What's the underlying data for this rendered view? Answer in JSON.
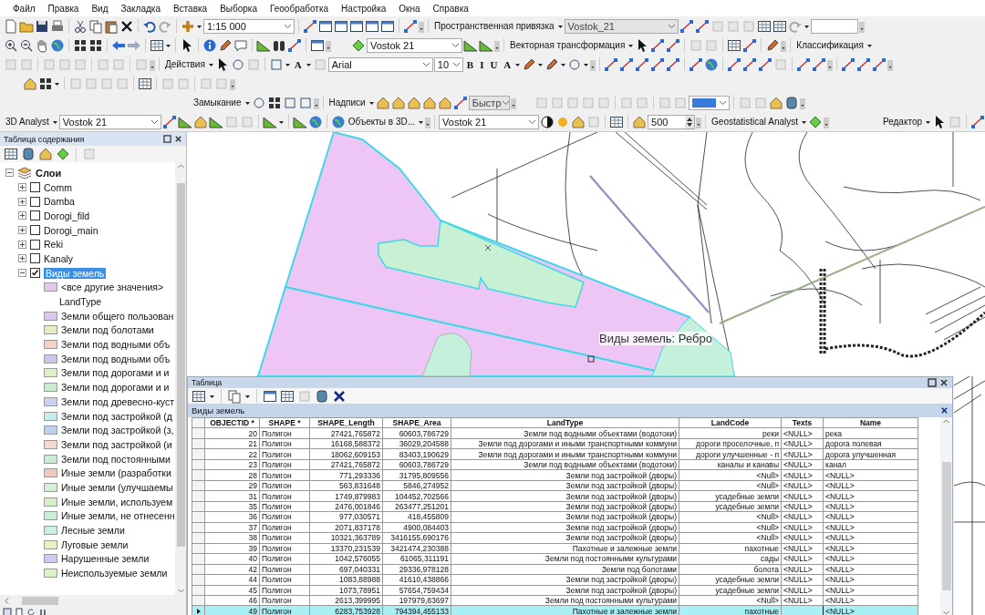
{
  "menu": [
    "Файл",
    "Правка",
    "Вид",
    "Закладка",
    "Вставка",
    "Выборка",
    "Геообработка",
    "Настройка",
    "Окна",
    "Справка"
  ],
  "toolbars": {
    "scale": "1:15 000",
    "georef_label": "Пространственная привязка",
    "georef_layer": {
      "value": "Vostok_21",
      "disabled": true
    },
    "layer_combo": "Vostok 21",
    "vector_transform": "Векторная трансформация",
    "classification": "Классификация",
    "actions": "Действия",
    "font": "Arial",
    "font_size": "10",
    "glyphs": [
      "A",
      "B",
      "I",
      "U",
      "A"
    ],
    "snapping": "Замыкание",
    "labels": "Надписи",
    "quick": {
      "value": "Быстр",
      "disabled": true
    },
    "analyst3d": "3D Analyst",
    "analyst3d_layer": "Vostok 21",
    "objects3d": "Объекты в 3D...",
    "layer_combo2": "Vostok 21",
    "distance": "500",
    "geostat": "Geostatistical Analyst",
    "editor": "Редактор"
  },
  "toc": {
    "title": "Таблица содержания",
    "root": {
      "label": "Слои",
      "expanded": true
    },
    "layers": [
      {
        "name": "Comm",
        "checked": false,
        "expanded": false,
        "selected": false
      },
      {
        "name": "Damba",
        "checked": false,
        "expanded": false,
        "selected": false
      },
      {
        "name": "Dorogi_fild",
        "checked": false,
        "expanded": false,
        "selected": false
      },
      {
        "name": "Dorogi_main",
        "checked": false,
        "expanded": false,
        "selected": false
      },
      {
        "name": "Reki",
        "checked": false,
        "expanded": false,
        "selected": false
      },
      {
        "name": "Kanaly",
        "checked": false,
        "expanded": false,
        "selected": false
      },
      {
        "name": "Виды земель",
        "checked": true,
        "expanded": true,
        "selected": true,
        "children": [
          {
            "kind": "swatch",
            "label": "<все другие значения>",
            "color": "#e6c6f0"
          },
          {
            "kind": "heading",
            "label": "LandType"
          },
          {
            "kind": "swatch",
            "label": "Земли общего пользован",
            "color": "#dcc6ee"
          },
          {
            "kind": "swatch",
            "label": "Земли под болотами",
            "color": "#e8ecc0"
          },
          {
            "kind": "swatch",
            "label": "Земли под водными объ",
            "color": "#f2d2c2"
          },
          {
            "kind": "swatch",
            "label": "Земли под водными объ",
            "color": "#c9c6ec"
          },
          {
            "kind": "swatch",
            "label": "Земли под дорогами и и",
            "color": "#def0c6"
          },
          {
            "kind": "swatch",
            "label": "Земли под дорогами и и",
            "color": "#c8ecd0"
          },
          {
            "kind": "swatch",
            "label": "Земли под древесно-куст",
            "color": "#c8d2f0"
          },
          {
            "kind": "swatch",
            "label": "Земли под застройкой (д",
            "color": "#c6ecec"
          },
          {
            "kind": "swatch",
            "label": "Земли под застройкой (з,",
            "color": "#bed0f0"
          },
          {
            "kind": "swatch",
            "label": "Земли под застройкой (и",
            "color": "#f4d8d0"
          },
          {
            "kind": "swatch",
            "label": "Земли под постоянными",
            "color": "#c8ecd4"
          },
          {
            "kind": "swatch",
            "label": "Иные земли (разработки",
            "color": "#f0c8c0"
          },
          {
            "kind": "swatch",
            "label": "Иные земли (улучшаемы",
            "color": "#d0f0d8"
          },
          {
            "kind": "swatch",
            "label": "Иные земли, используем",
            "color": "#d4f0c8"
          },
          {
            "kind": "swatch",
            "label": "Иные земли, не отнесенн",
            "color": "#c8f0d8"
          },
          {
            "kind": "swatch",
            "label": "Лесные земли",
            "color": "#c8f0e2"
          },
          {
            "kind": "swatch",
            "label": "Луговые земли",
            "color": "#ecf0c0"
          },
          {
            "kind": "swatch",
            "label": "Нарушенные земли",
            "color": "#d0c8f0"
          },
          {
            "kind": "swatch",
            "label": "Неиспользуемые земли",
            "color": "#d8f4c8"
          }
        ]
      }
    ]
  },
  "map": {
    "snap_tip": "Виды земель: Ребро"
  },
  "table": {
    "title": "Таблица",
    "layer_tab": "Виды земель",
    "columns": [
      "OBJECTID *",
      "SHAPE *",
      "SHAPE_Length",
      "SHAPE_Area",
      "LandType",
      "LandCode",
      "Texts",
      "Name"
    ],
    "rows": [
      {
        "objectid": "20",
        "shape": "Полигон",
        "shape_length": "27421,765872",
        "shape_area": "60603,786729",
        "landtype": "Земли под водными объектами (водотоки)",
        "landcode": "реки",
        "texts": "<NULL>",
        "name": "река",
        "selected": false
      },
      {
        "objectid": "21",
        "shape": "Полигон",
        "shape_length": "16168,588372",
        "shape_area": "36029,204588",
        "landtype": "Земли под дорогами и иными транспортными коммуни",
        "landcode": "дороги проселочные, п",
        "texts": "<NULL>",
        "name": "дорога полевая",
        "selected": false
      },
      {
        "objectid": "22",
        "shape": "Полигон",
        "shape_length": "18062,609153",
        "shape_area": "83403,190629",
        "landtype": "Земли под дорогами и иными транспортными коммуни",
        "landcode": "дороги улучшенные - п",
        "texts": "<NULL>",
        "name": "дорога улучшенная",
        "selected": false
      },
      {
        "objectid": "23",
        "shape": "Полигон",
        "shape_length": "27421,765872",
        "shape_area": "60603,786729",
        "landtype": "Земли под водными объектами (водотоки)",
        "landcode": "каналы и канавы",
        "texts": "<NULL>",
        "name": "канал",
        "selected": false
      },
      {
        "objectid": "28",
        "shape": "Полигон",
        "shape_length": "771,293336",
        "shape_area": "31795,809556",
        "landtype": "Земли под застройкой (дворы)",
        "landcode": "<Null>",
        "texts": "<NULL>",
        "name": "<NULL>",
        "selected": false
      },
      {
        "objectid": "29",
        "shape": "Полигон",
        "shape_length": "563,831648",
        "shape_area": "5846,274952",
        "landtype": "Земли под застройкой (дворы)",
        "landcode": "<Null>",
        "texts": "<NULL>",
        "name": "<NULL>",
        "selected": false
      },
      {
        "objectid": "31",
        "shape": "Полигон",
        "shape_length": "1749,879983",
        "shape_area": "104452,702566",
        "landtype": "Земли под застройкой (дворы)",
        "landcode": "усадебные земли",
        "texts": "<NULL>",
        "name": "<NULL>",
        "selected": false
      },
      {
        "objectid": "35",
        "shape": "Полигон",
        "shape_length": "2476,001846",
        "shape_area": "263477,251201",
        "landtype": "Земли под застройкой (дворы)",
        "landcode": "усадебные земли",
        "texts": "<NULL>",
        "name": "<NULL>",
        "selected": false
      },
      {
        "objectid": "36",
        "shape": "Полигон",
        "shape_length": "977,030571",
        "shape_area": "418,455809",
        "landtype": "Земли под застройкой (дворы)",
        "landcode": "<Null>",
        "texts": "<NULL>",
        "name": "<NULL>",
        "selected": false
      },
      {
        "objectid": "37",
        "shape": "Полигон",
        "shape_length": "2071,837178",
        "shape_area": "4900,084403",
        "landtype": "Земли под застройкой (дворы)",
        "landcode": "<Null>",
        "texts": "<NULL>",
        "name": "<NULL>",
        "selected": false
      },
      {
        "objectid": "38",
        "shape": "Полигон",
        "shape_length": "10321,363789",
        "shape_area": "3416155,690176",
        "landtype": "Земли под застройкой (дворы)",
        "landcode": "<Null>",
        "texts": "<NULL>",
        "name": "<NULL>",
        "selected": false
      },
      {
        "objectid": "39",
        "shape": "Полигон",
        "shape_length": "13370,231539",
        "shape_area": "3421474,230388",
        "landtype": "Пахотные и залежные земли",
        "landcode": "пахотные",
        "texts": "<NULL>",
        "name": "<NULL>",
        "selected": false
      },
      {
        "objectid": "40",
        "shape": "Полигон",
        "shape_length": "1042,576055",
        "shape_area": "61065,311191",
        "landtype": "Земли под постоянными культурами",
        "landcode": "сады",
        "texts": "<NULL>",
        "name": "<NULL>",
        "selected": false
      },
      {
        "objectid": "42",
        "shape": "Полигон",
        "shape_length": "697,040331",
        "shape_area": "29336,978128",
        "landtype": "Земли под болотами",
        "landcode": "болота",
        "texts": "<NULL>",
        "name": "<NULL>",
        "selected": false
      },
      {
        "objectid": "44",
        "shape": "Полигон",
        "shape_length": "1083,88988",
        "shape_area": "41610,438866",
        "landtype": "Земли под застройкой (дворы)",
        "landcode": "усадебные земли",
        "texts": "<NULL>",
        "name": "<NULL>",
        "selected": false
      },
      {
        "objectid": "45",
        "shape": "Полигон",
        "shape_length": "1073,78951",
        "shape_area": "57654,759434",
        "landtype": "Земли под застройкой (дворы)",
        "landcode": "усадебные земли",
        "texts": "<NULL>",
        "name": "<NULL>",
        "selected": false
      },
      {
        "objectid": "46",
        "shape": "Полигон",
        "shape_length": "2613,399995",
        "shape_area": "197979,83697",
        "landtype": "Земли под постоянными культурами",
        "landcode": "<Null>",
        "texts": "<NULL>",
        "name": "<NULL>",
        "selected": false
      },
      {
        "objectid": "49",
        "shape": "Полигон",
        "shape_length": "6283,753928",
        "shape_area": "794394,455133",
        "landtype": "Пахотные и залежные земли",
        "landcode": "пахотные",
        "name": "<NULL>",
        "selected": true
      }
    ]
  }
}
